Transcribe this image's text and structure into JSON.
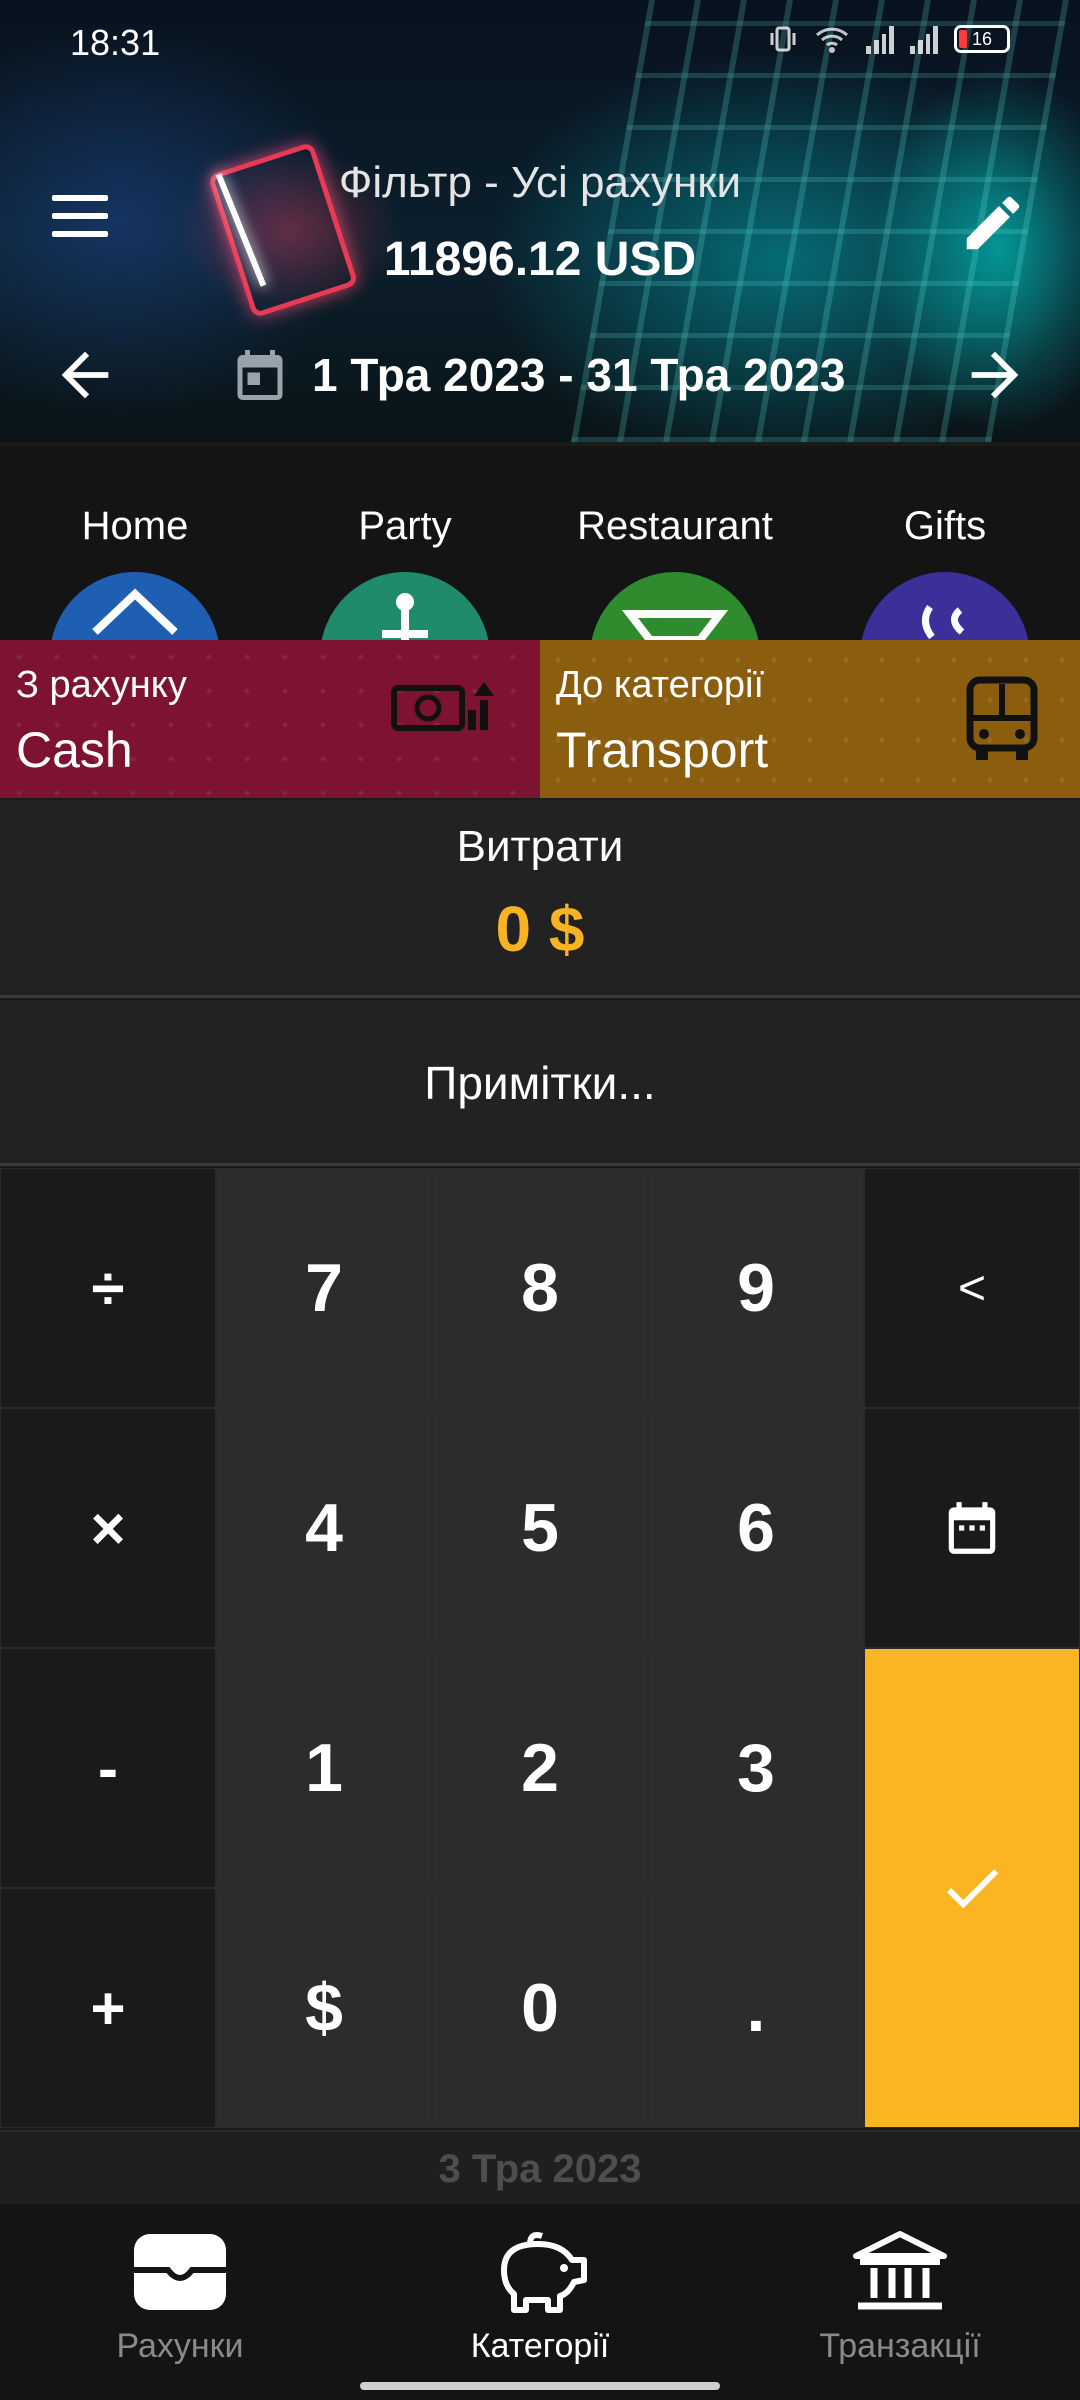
{
  "status_bar": {
    "time": "18:31",
    "battery": "16"
  },
  "header": {
    "filter_title": "Фільтр - Усі рахунки",
    "balance": "11896.12 USD",
    "period": "1 Тра 2023 - 31 Тра 2023"
  },
  "categories": [
    {
      "label": "Home",
      "color": "#1e5fb3",
      "icon": "house-icon"
    },
    {
      "label": "Party",
      "color": "#1f8a6c",
      "icon": "cake-icon"
    },
    {
      "label": "Restaurant",
      "color": "#2e8b2e",
      "icon": "bowl-icon"
    },
    {
      "label": "Gifts",
      "color": "#3b2f9a",
      "icon": "ribbon-icon"
    }
  ],
  "from_account": {
    "label": "З рахунку",
    "value": "Cash",
    "color": "#7d1330",
    "icon": "money-icon"
  },
  "to_category": {
    "label": "До категорії",
    "value": "Transport",
    "color": "#8b5e0f",
    "icon": "bus-icon"
  },
  "amount": {
    "label": "Витрати",
    "value": "0 $",
    "color": "#f7b324"
  },
  "notes": {
    "placeholder": "Примітки..."
  },
  "keypad": {
    "divide": "÷",
    "multiply": "×",
    "minus": "-",
    "plus": "+",
    "k7": "7",
    "k8": "8",
    "k9": "9",
    "k4": "4",
    "k5": "5",
    "k6": "6",
    "k1": "1",
    "k2": "2",
    "k3": "3",
    "currency": "$",
    "k0": "0",
    "dot": ".",
    "backspace": "<"
  },
  "date_bar": "3 Тра 2023",
  "bottom_nav": [
    {
      "label": "Рахунки",
      "icon": "wallet-icon",
      "active": false
    },
    {
      "label": "Категорії",
      "icon": "piggy-bank-icon",
      "active": true
    },
    {
      "label": "Транзакції",
      "icon": "bank-icon",
      "active": false
    }
  ]
}
